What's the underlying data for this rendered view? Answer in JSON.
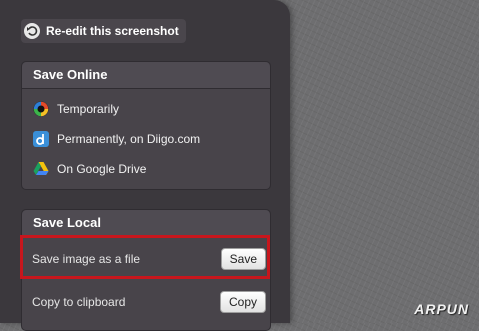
{
  "reedit": {
    "label": "Re-edit this screenshot",
    "icon": "undo-icon"
  },
  "online": {
    "title": "Save Online",
    "items": [
      {
        "label": "Temporarily",
        "icon": "camera-lens-icon"
      },
      {
        "label": "Permanently, on Diigo.com",
        "icon": "diigo-icon"
      },
      {
        "label": "On Google Drive",
        "icon": "google-drive-icon"
      }
    ]
  },
  "local": {
    "title": "Save Local",
    "save_file": {
      "label": "Save image as a file",
      "button": "Save"
    },
    "clipboard": {
      "label": "Copy to clipboard",
      "button": "Copy"
    }
  },
  "colors": {
    "highlight": "#c8161d",
    "panel": "#3b383d"
  },
  "watermark": "ARPUN"
}
